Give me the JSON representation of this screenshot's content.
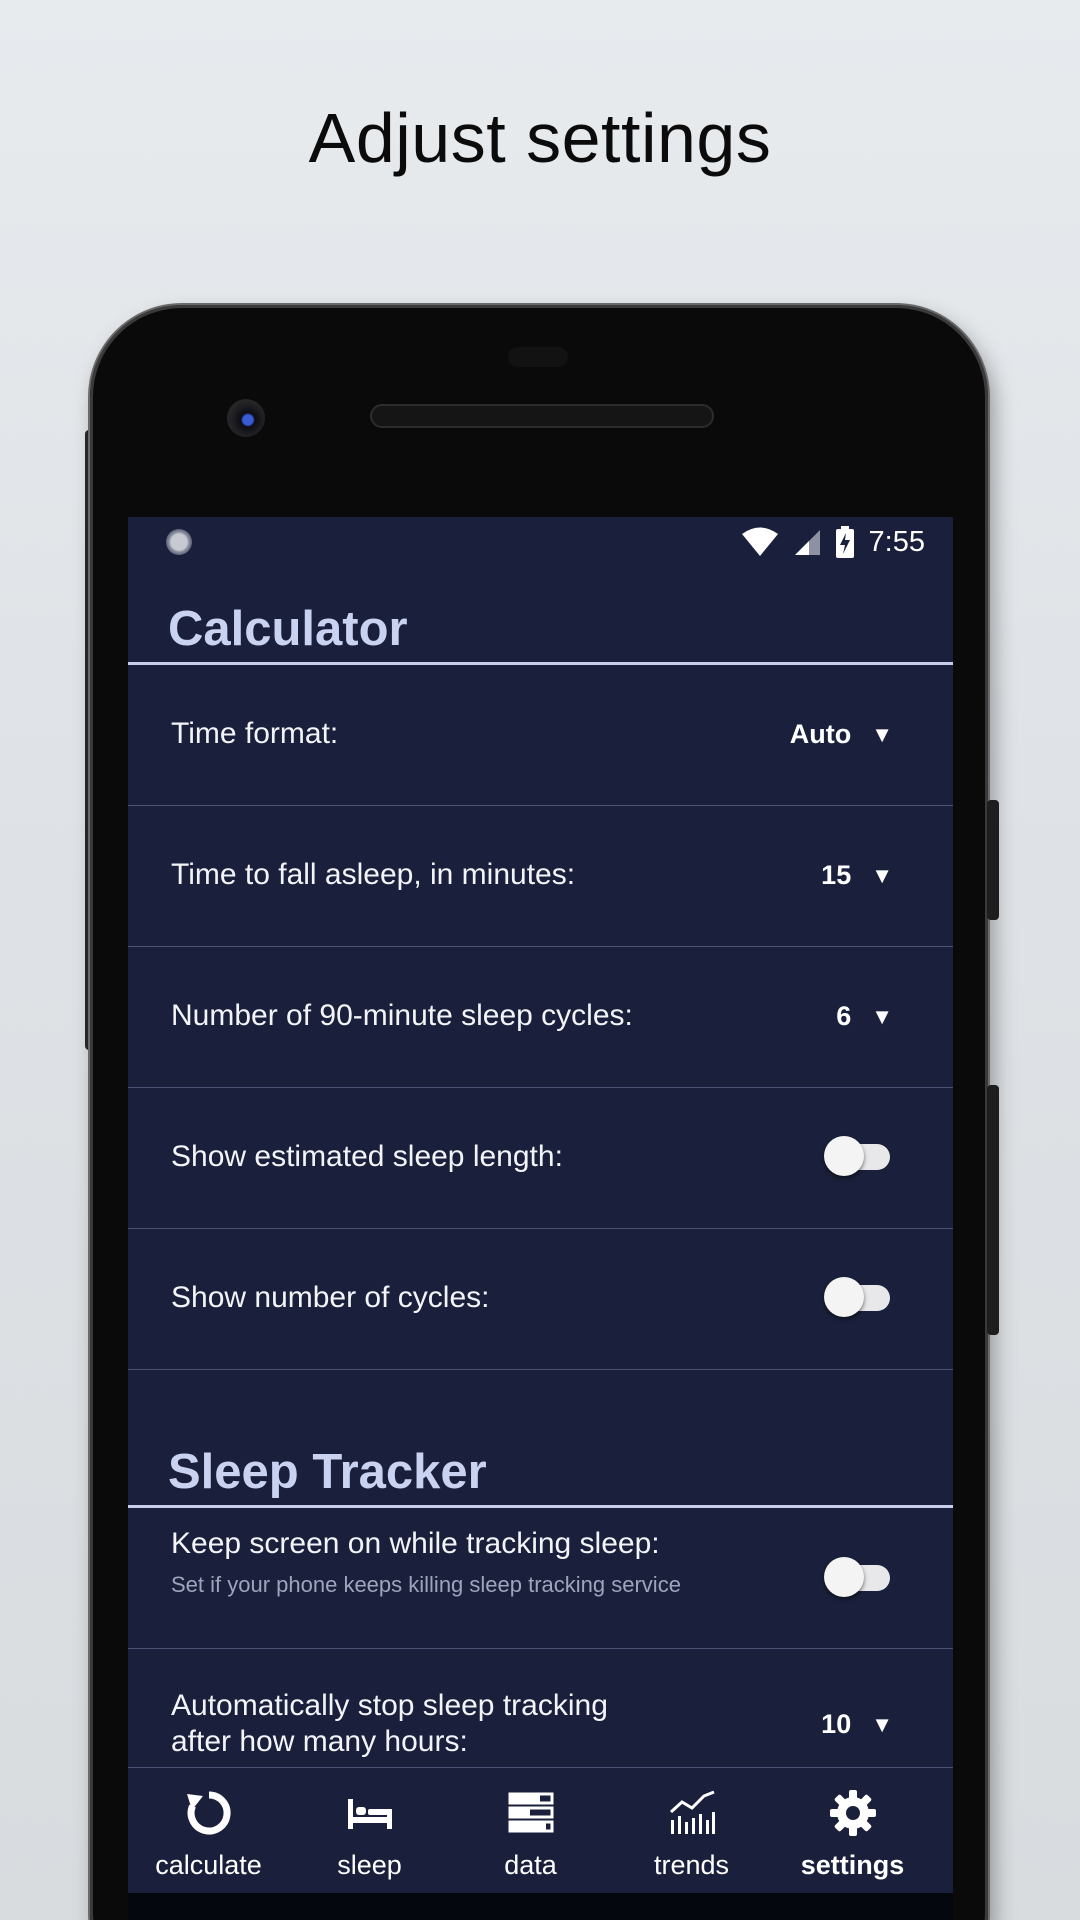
{
  "promo": {
    "title": "Adjust settings"
  },
  "statusbar": {
    "time": "7:55",
    "icons": [
      "notification-dot-icon",
      "wifi-icon",
      "cell-signal-icon",
      "battery-charging-icon"
    ]
  },
  "calculator": {
    "header": "Calculator",
    "rows": [
      {
        "label": "Time format:",
        "value": "Auto",
        "control": "dropdown"
      },
      {
        "label": "Time to fall asleep, in minutes:",
        "value": "15",
        "control": "dropdown"
      },
      {
        "label": "Number of 90-minute sleep cycles:",
        "value": "6",
        "control": "dropdown"
      },
      {
        "label": "Show estimated sleep length:",
        "control": "toggle",
        "state": "off"
      },
      {
        "label": "Show number of cycles:",
        "control": "toggle",
        "state": "off"
      }
    ]
  },
  "tracker": {
    "header": "Sleep Tracker",
    "rows": [
      {
        "label": "Keep screen on while tracking sleep:",
        "sublabel": "Set if your phone keeps killing sleep tracking service",
        "control": "toggle",
        "state": "off"
      },
      {
        "label_line1": "Automatically stop sleep tracking",
        "label_line2": "after how many hours:",
        "value": "10",
        "control": "dropdown"
      }
    ]
  },
  "dropdown_arrow": "▼",
  "nav": {
    "active": "settings",
    "items": [
      {
        "label": "calculate",
        "icon": "refresh-icon"
      },
      {
        "label": "sleep",
        "icon": "bed-icon"
      },
      {
        "label": "data",
        "icon": "list-icon"
      },
      {
        "label": "trends",
        "icon": "trend-chart-icon"
      },
      {
        "label": "settings",
        "icon": "gear-icon"
      }
    ]
  },
  "colors": {
    "screen_bg": "#1a203b",
    "header_text": "#c9d3f1",
    "divider": "#4b5273",
    "page_bg": "#e3e7ea"
  }
}
